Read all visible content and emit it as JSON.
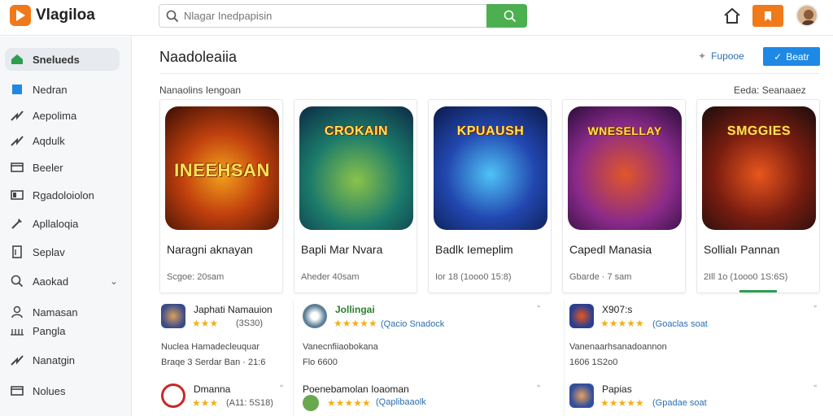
{
  "app": {
    "name": "Vlagiloa"
  },
  "search": {
    "placeholder": "Nlagar Inedpapisin"
  },
  "sidebar": {
    "items": [
      {
        "label": "Snelueds",
        "icon": "home-icon",
        "active": true
      },
      {
        "label": "Nedran",
        "icon": "square-icon"
      },
      {
        "label": "Aepolima",
        "icon": "arrow-icon"
      },
      {
        "label": "Aqdulk",
        "icon": "arrow-icon"
      },
      {
        "label": "Beeler",
        "icon": "card-icon"
      },
      {
        "label": "Rgadoloiolon",
        "icon": "card-icon"
      },
      {
        "label": "Apllaloqia",
        "icon": "wand-icon"
      },
      {
        "label": "Seplav",
        "icon": "doc-icon"
      },
      {
        "label": "Aaokad",
        "icon": "search-icon"
      },
      {
        "label": "Namasan",
        "icon": "user-icon"
      },
      {
        "label": "Pangla",
        "icon": "grid-icon"
      },
      {
        "label": "Nanatgin",
        "icon": "arrow-icon"
      },
      {
        "label": "Nolues",
        "icon": "card-icon"
      }
    ]
  },
  "main": {
    "title": "Naadoleaiia",
    "filter_label": "Fupooe",
    "primary_button": "Beatr",
    "section_label": "Nanaolins Iengoan",
    "section_right": "Eeda: Seanaaez"
  },
  "cards": [
    {
      "art_title": "INEEHSAN",
      "name": "Naragni aknayan",
      "sub": "Scgoe: 20sam",
      "colors": [
        "#8a2b0e",
        "#f3a11c"
      ]
    },
    {
      "art_title": "CROKAIN",
      "name": "Bapli Mar Nvara",
      "sub": "Aheder 40sam",
      "colors": [
        "#1b5e7a",
        "#8bc34a"
      ]
    },
    {
      "art_title": "KPUAUSH",
      "name": "Badlk Iemeplim",
      "sub": "Ior 18 (1ooo0 15:8)",
      "colors": [
        "#1c3e8f",
        "#4fc3f7"
      ]
    },
    {
      "art_title": "WNESELLAY",
      "name": "Capedl Manasia",
      "sub": "Gbarde · 7 sam",
      "colors": [
        "#5b1a6e",
        "#e0562a"
      ]
    },
    {
      "art_title": "SMGGIES",
      "name": "Sollialı Pannan",
      "sub": "2Ill 1o (1ooo0 1S:6S)",
      "colors": [
        "#2a1a1a",
        "#e8561d"
      ]
    }
  ],
  "list": [
    {
      "title": "Japhati Namauion",
      "stars": "★★★",
      "meta": "(3S30)",
      "desc": "Nuclea Hamadecleuquar",
      "desc2": "Braqe 3 Serdar Ban · 21:6",
      "color": "#3a4a8a"
    },
    {
      "title": "Jollingai",
      "stars": "★★★★★",
      "meta": "(Qacio Snadock",
      "desc": "Vanecnfiiaobokana",
      "desc2": "Flo 6600",
      "color": "#5d7d95"
    },
    {
      "title": "X907:s",
      "stars": "★★★★★",
      "meta": "(Goaclas soat",
      "desc": "Vanenaarhsanadoannon",
      "desc2": "1606 1S2o0",
      "color": "#2c3f8f"
    },
    {
      "title": "Dmanna",
      "stars": "★★★",
      "meta": "(A11: 5S18)",
      "desc": "",
      "desc2": "",
      "color": "#c62828"
    },
    {
      "title": "Poenebamolan Ioaoman",
      "stars": "★★★★★",
      "meta": "(Qaplibaaolk",
      "desc": "",
      "desc2": "",
      "color": "#6aa84f"
    },
    {
      "title": "Papias",
      "stars": "★★★★★",
      "meta": "(Gpadae soat",
      "desc": "",
      "desc2": "",
      "color": "#334f9b"
    }
  ]
}
